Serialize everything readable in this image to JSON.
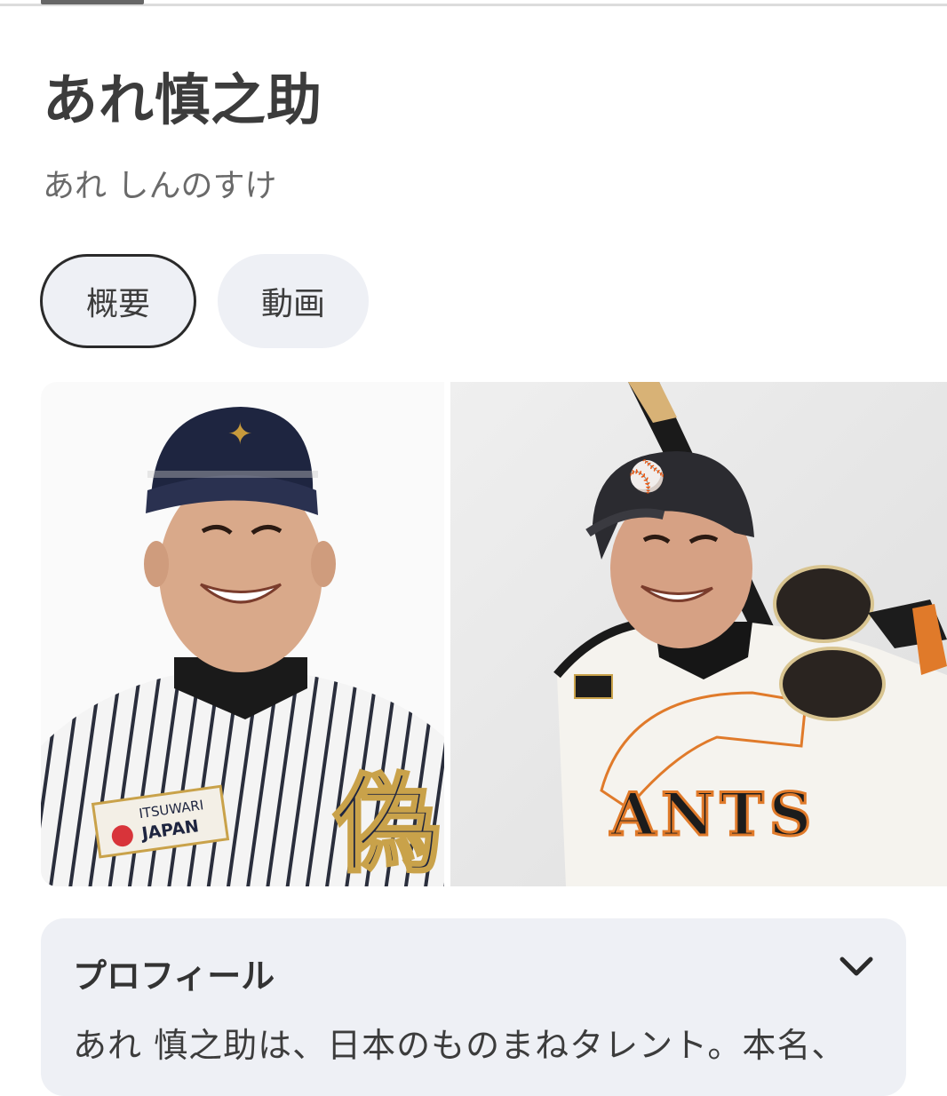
{
  "header": {
    "title": "あれ慎之助",
    "reading": "あれ しんのすけ"
  },
  "tabs": [
    {
      "label": "概要",
      "active": true
    },
    {
      "label": "動画",
      "active": false
    }
  ],
  "images": {
    "left": {
      "logo_line1": "ITSUWARI",
      "logo_line2": "JAPAN",
      "jersey_kanji": "偽"
    },
    "right": {
      "jersey_text": "ANTS"
    }
  },
  "profile": {
    "title": "プロフィール",
    "text": "あれ 慎之助は、日本のものまねタレント。本名、",
    "expand_icon": "chevron-down-icon"
  }
}
